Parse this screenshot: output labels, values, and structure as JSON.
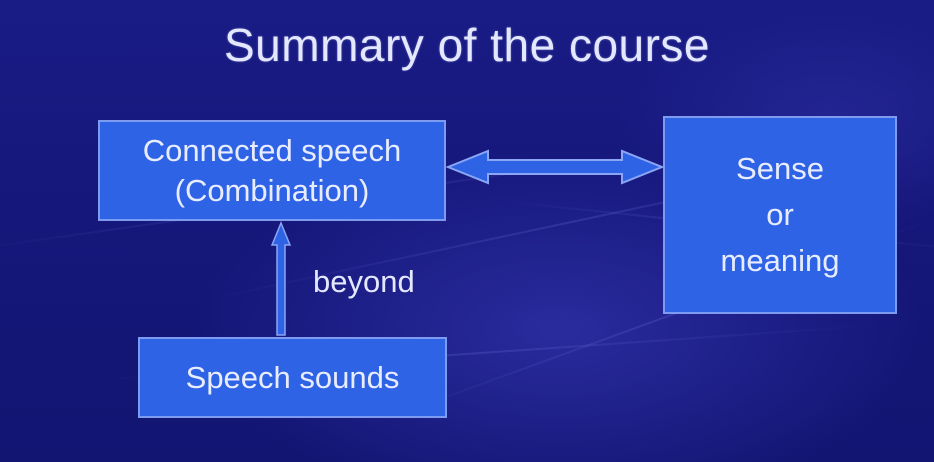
{
  "slide": {
    "title": "Summary of the course",
    "connected_box": {
      "line1": "Connected speech",
      "line2": "(Combination)"
    },
    "sense_box": {
      "line1": "Sense",
      "line2": "or",
      "line3": "meaning"
    },
    "sounds_box": {
      "label": "Speech sounds"
    },
    "arrow_label": "beyond"
  },
  "colors": {
    "background": "#17197e",
    "box_fill": "#2f63e6",
    "box_border": "#7d9bf0",
    "text": "#e4e8ff"
  }
}
